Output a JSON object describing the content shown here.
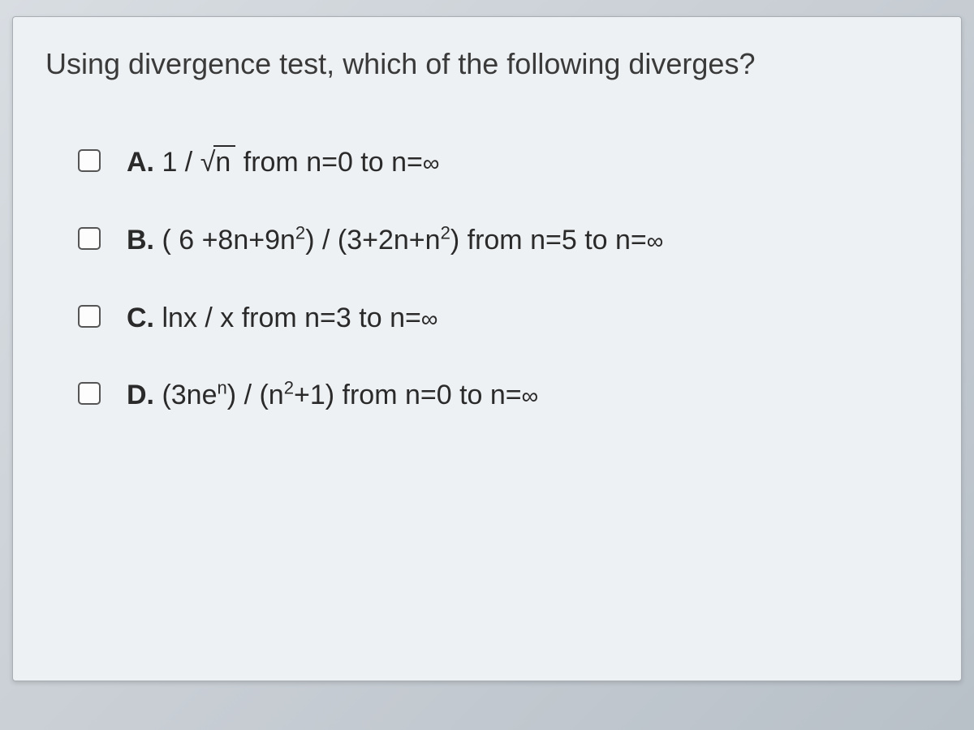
{
  "question": {
    "prompt": "Using divergence test, which of the following diverges?"
  },
  "options": {
    "a": {
      "letter": "A.",
      "pre": " 1 / ",
      "radicand": "n",
      "post": "  from n=0 to n=",
      "inf": "∞"
    },
    "b": {
      "letter": "B.",
      "text": " ( 6 +8n+9n",
      "sup1": "2",
      "mid": ") / (3+2n+n",
      "sup2": "2",
      "post": ") from n=5 to n=",
      "inf": "∞"
    },
    "c": {
      "letter": "C.",
      "text": " lnx / x from n=3 to n=",
      "inf": "∞"
    },
    "d": {
      "letter": "D.",
      "text": " (3ne",
      "sup1": "n",
      "mid": ") / (n",
      "sup2": "2",
      "post": "+1) from n=0 to n=",
      "inf": "∞"
    }
  }
}
